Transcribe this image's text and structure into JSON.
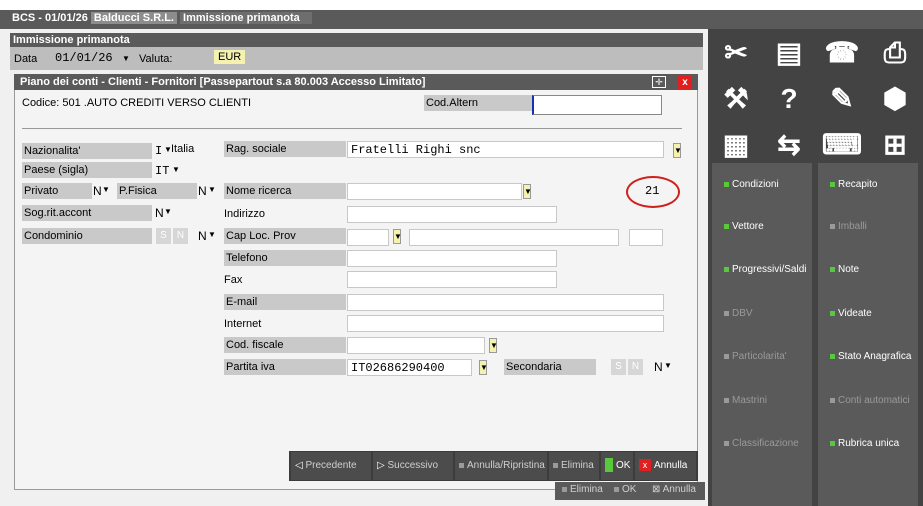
{
  "tab": {
    "app": "BCS - 01/01/26",
    "company": "Balducci S.R.L.",
    "title": "Immissione primanota"
  },
  "header": {
    "title": "Immissione primanota",
    "data_label": "Data",
    "data_value": "01/01/26",
    "valuta_label": "Valuta:",
    "valuta_value": "EUR"
  },
  "dialog": {
    "title": "Piano dei conti - Clienti - Fornitori [Passepartout s.a 80.003 Accesso Limitato]",
    "codice_label": "Codice: 501 .AUTO CREDITI VERSO CLIENTI",
    "cod_altern_label": "Cod.Altern",
    "nazionalita_label": "Nazionalita'",
    "nazionalita_value": "I",
    "nazionalita_text": "Italia",
    "paese_label": "Paese (sigla)",
    "paese_value": "IT",
    "privato_label": "Privato",
    "privato_value": "N",
    "pfisica_label": "P.Fisica",
    "pfisica_value": "N",
    "sogrit_label": "Sog.rit.accont",
    "sogrit_value": "N",
    "condominio_label": "Condominio",
    "condominio_s": "S",
    "condominio_n": "N",
    "condominio_value": "N",
    "ragsoc_label": "Rag. sociale",
    "ragsoc_value": "Fratelli Righi snc",
    "nome_ricerca_label": "Nome ricerca",
    "indirizzo_label": "Indirizzo",
    "cap_label": "Cap Loc. Prov",
    "telefono_label": "Telefono",
    "fax_label": "Fax",
    "email_label": "E-mail",
    "internet_label": "Internet",
    "codfisc_label": "Cod. fiscale",
    "piva_label": "Partita iva",
    "piva_value": "IT02686290400",
    "secondaria_label": "Secondaria",
    "secondaria_s": "S",
    "secondaria_n": "N",
    "secondaria_value": "N",
    "annotation": "21"
  },
  "bottom_buttons": {
    "precedente": "Precedente",
    "successivo": "Successivo",
    "annulla_ripristina": "Annulla/Ripristina",
    "elimina": "Elimina",
    "ok": "OK",
    "annulla": "Annulla"
  },
  "under_buttons": {
    "elimina": "Elimina",
    "ok": "OK",
    "annulla": "Annulla"
  },
  "sidebar": {
    "buttons": [
      {
        "label": "Condizioni",
        "enabled": true
      },
      {
        "label": "Recapito",
        "enabled": true
      },
      {
        "label": "Vettore",
        "enabled": true
      },
      {
        "label": "Imballi",
        "enabled": false
      },
      {
        "label": "Progressivi/Saldi",
        "enabled": true
      },
      {
        "label": "Note",
        "enabled": true
      },
      {
        "label": "DBV",
        "enabled": false
      },
      {
        "label": "Videate",
        "enabled": true
      },
      {
        "label": "Particolarita'",
        "enabled": false
      },
      {
        "label": "Stato Anagrafica",
        "enabled": true
      },
      {
        "label": "Mastrini",
        "enabled": false
      },
      {
        "label": "Conti automatici",
        "enabled": false
      },
      {
        "label": "Classificazione",
        "enabled": false
      },
      {
        "label": "Rubrica unica",
        "enabled": true
      }
    ]
  },
  "colors": {
    "accent_green": "#5ac83c",
    "title_grey": "#5a5a5a",
    "annotation_red": "#d0201c",
    "close_red": "#e02020"
  }
}
